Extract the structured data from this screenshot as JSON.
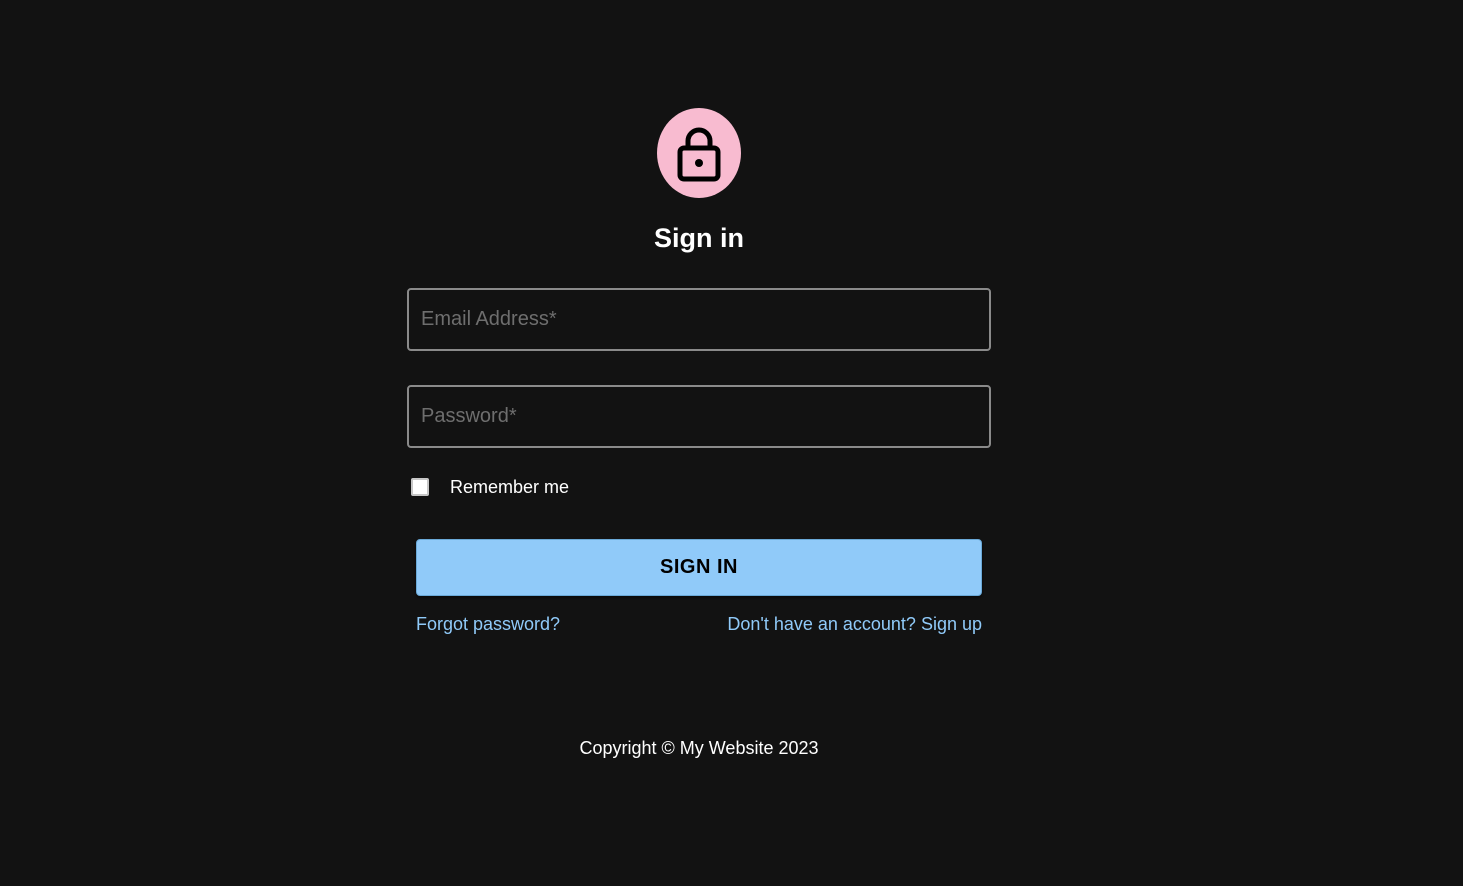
{
  "header": {
    "icon": "lock-icon",
    "icon_bg_color": "#f8bbd0",
    "title": "Sign in"
  },
  "form": {
    "email": {
      "placeholder": "Email Address*",
      "value": ""
    },
    "password": {
      "placeholder": "Password*",
      "value": ""
    },
    "remember": {
      "label": "Remember me",
      "checked": false
    },
    "submit_label": "SIGN IN",
    "submit_color": "#90caf9"
  },
  "links": {
    "forgot": "Forgot password?",
    "signup": "Don't have an account? Sign up",
    "color": "#90caf9"
  },
  "footer": {
    "copyright": "Copyright © My Website 2023"
  }
}
